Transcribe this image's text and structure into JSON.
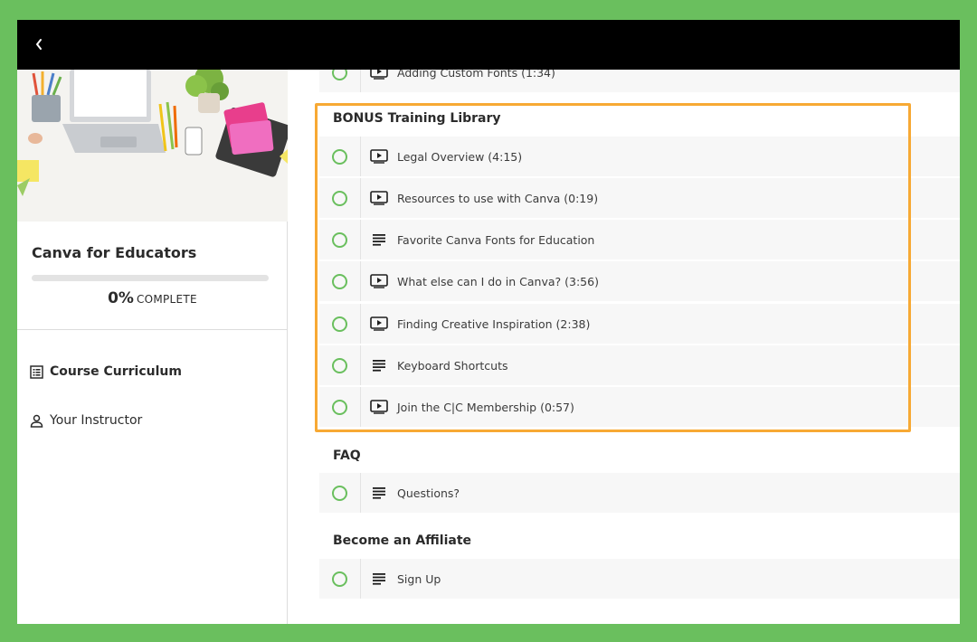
{
  "course": {
    "title": "Canva for Educators",
    "progress_percent": "0%",
    "progress_label": "COMPLETE",
    "progress_fraction": 0
  },
  "nav": {
    "curriculum": "Course Curriculum",
    "instructor": "Your Instructor"
  },
  "partial_lesson": {
    "label": "Adding Custom Fonts (1:34)",
    "icon": "video-icon"
  },
  "sections": [
    {
      "title": "BONUS Training Library",
      "lessons": [
        {
          "label": "Legal Overview (4:15)",
          "icon": "video-icon"
        },
        {
          "label": "Resources to use with Canva (0:19)",
          "icon": "video-icon"
        },
        {
          "label": "Favorite Canva Fonts for Education",
          "icon": "text-icon"
        },
        {
          "label": "What else can I do in Canva? (3:56)",
          "icon": "video-icon"
        },
        {
          "label": "Finding Creative Inspiration (2:38)",
          "icon": "video-icon"
        },
        {
          "label": "Keyboard Shortcuts",
          "icon": "text-icon"
        },
        {
          "label": "Join the C|C Membership (0:57)",
          "icon": "video-icon"
        }
      ]
    },
    {
      "title": "FAQ",
      "lessons": [
        {
          "label": "Questions?",
          "icon": "text-icon"
        }
      ]
    },
    {
      "title": "Become an Affiliate",
      "lessons": [
        {
          "label": "Sign Up",
          "icon": "text-icon"
        }
      ]
    }
  ],
  "colors": {
    "frame": "#6abf5e",
    "check": "#6abf5e",
    "highlight": "#f7a934",
    "topbar": "#000000"
  }
}
